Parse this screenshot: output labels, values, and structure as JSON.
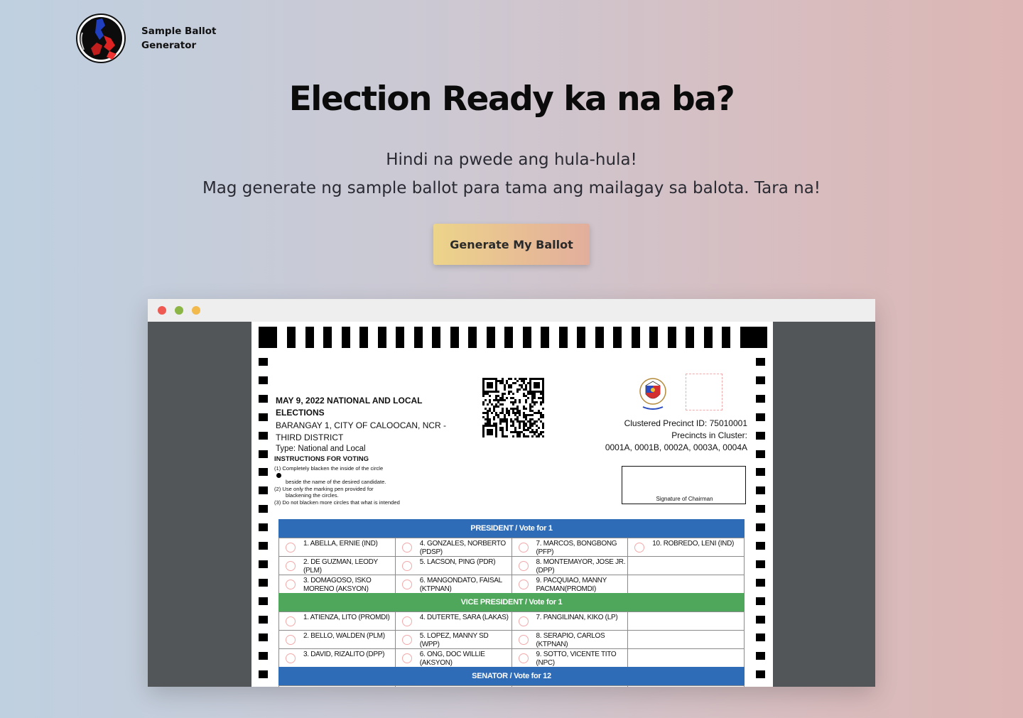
{
  "brand": {
    "name_line1": "Sample Ballot",
    "name_line2": "Generator"
  },
  "hero": {
    "headline": "Election Ready ka na ba?",
    "subline1": "Hindi na pwede ang hula-hula!",
    "subline2": "Mag generate ng sample ballot para tama ang mailagay sa balota. Tara na!",
    "cta_label": "Generate My Ballot"
  },
  "ballot": {
    "election": "MAY 9, 2022 NATIONAL AND LOCAL ELECTIONS",
    "barangay": "BARANGAY   1, CITY OF CALOOCAN, NCR - THIRD DISTRICT",
    "type": "Type: National and Local",
    "instructions_title": "INSTRUCTIONS FOR VOTING",
    "instructions": [
      "(1) Completely blacken the inside of the circle",
      "beside the name of the desired candidate.",
      "(2) Use only the marking pen provided for",
      "blackening the circles.",
      "(3) Do not blacken more circles that what is intended"
    ],
    "precinct_id": "Clustered Precinct ID: 75010001",
    "precincts_label": "Precincts in Cluster:",
    "precincts_list": "0001A, 0001B, 0002A, 0003A, 0004A",
    "signature_label": "Signature of Chairman",
    "sections": {
      "president": {
        "title": "PRESIDENT  /  Vote for 1",
        "rows": [
          [
            "1. ABELLA, ERNIE (IND)",
            "4. GONZALES, NORBERTO (PDSP)",
            "7. MARCOS, BONGBONG (PFP)",
            "10. ROBREDO, LENI (IND)"
          ],
          [
            "2. DE GUZMAN, LEODY (PLM)",
            "5. LACSON, PING (PDR)",
            "8. MONTEMAYOR, JOSE JR. (DPP)",
            ""
          ],
          [
            "3. DOMAGOSO, ISKO MORENO (AKSYON)",
            "6. MANGONDATO, FAISAL (KTPNAN)",
            "9. PACQUIAO, MANNY PACMAN(PROMDI)",
            ""
          ]
        ]
      },
      "vice_president": {
        "title": "VICE PRESIDENT  /  Vote for 1",
        "rows": [
          [
            "1. ATIENZA, LITO (PROMDI)",
            "4. DUTERTE, SARA (LAKAS)",
            "7. PANGILINAN, KIKO (LP)",
            ""
          ],
          [
            "2. BELLO, WALDEN (PLM)",
            "5. LOPEZ, MANNY SD (WPP)",
            "8. SERAPIO, CARLOS (KTPNAN)",
            ""
          ],
          [
            "3. DAVID, RIZALITO (DPP)",
            "6. ONG, DOC WILLIE (AKSYON)",
            "9. SOTTO, VICENTE TITO (NPC)",
            ""
          ]
        ]
      },
      "senator": {
        "title": "SENATOR  /  Vote for 12"
      }
    }
  },
  "colors": {
    "section_blue": "#2f6cb8",
    "section_green": "#4ea75a",
    "cta_gradient_start": "#ecd48a",
    "cta_gradient_end": "#e2ae9c"
  },
  "icons": {
    "logo": "philippines-map-logo-icon",
    "qr": "qr-code-icon",
    "seal": "philippine-seal-icon"
  }
}
